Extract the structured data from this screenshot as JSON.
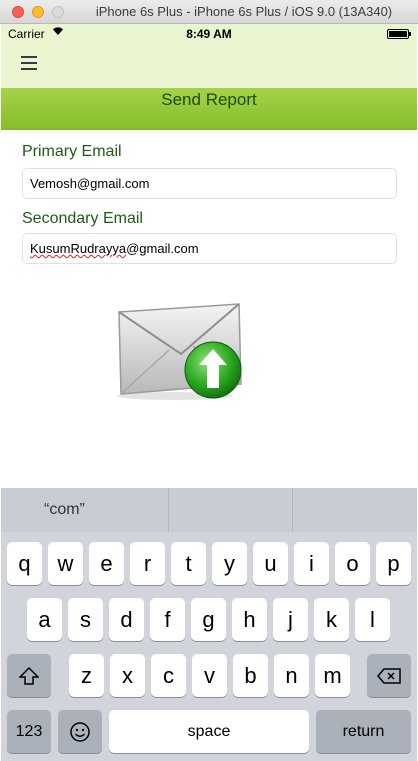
{
  "window": {
    "title": "iPhone 6s Plus - iPhone 6s Plus / iOS 9.0 (13A340)"
  },
  "status_bar": {
    "carrier": "Carrier",
    "time": "8:49 AM",
    "battery_level": 1.0
  },
  "nav": {
    "title": "Send Report"
  },
  "form": {
    "primary_label": "Primary Email",
    "primary_value": "Vemosh@gmail.com",
    "secondary_label": "Secondary Email",
    "secondary_value_misspelled": "KusumRudrayya",
    "secondary_value_rest": "@gmail.com"
  },
  "keyboard": {
    "suggestions": [
      "“com”",
      "",
      ""
    ],
    "row1": [
      "q",
      "w",
      "e",
      "r",
      "t",
      "y",
      "u",
      "i",
      "o",
      "p"
    ],
    "row2": [
      "a",
      "s",
      "d",
      "f",
      "g",
      "h",
      "j",
      "k",
      "l"
    ],
    "row3": [
      "z",
      "x",
      "c",
      "v",
      "b",
      "n",
      "m"
    ],
    "numbers_key": "123",
    "space_key": "space",
    "return_key": "return"
  },
  "colors": {
    "nav_background": "#e8f5d0",
    "title_band": "#96c83a",
    "label_green": "#1f5a16",
    "send_arrow": "#2aa81f"
  },
  "icons": {
    "menu": "hamburger-icon",
    "send": "send-email-icon",
    "shift": "shift-icon",
    "delete": "backspace-icon",
    "emoji": "emoji-icon",
    "wifi": "wifi-icon"
  }
}
